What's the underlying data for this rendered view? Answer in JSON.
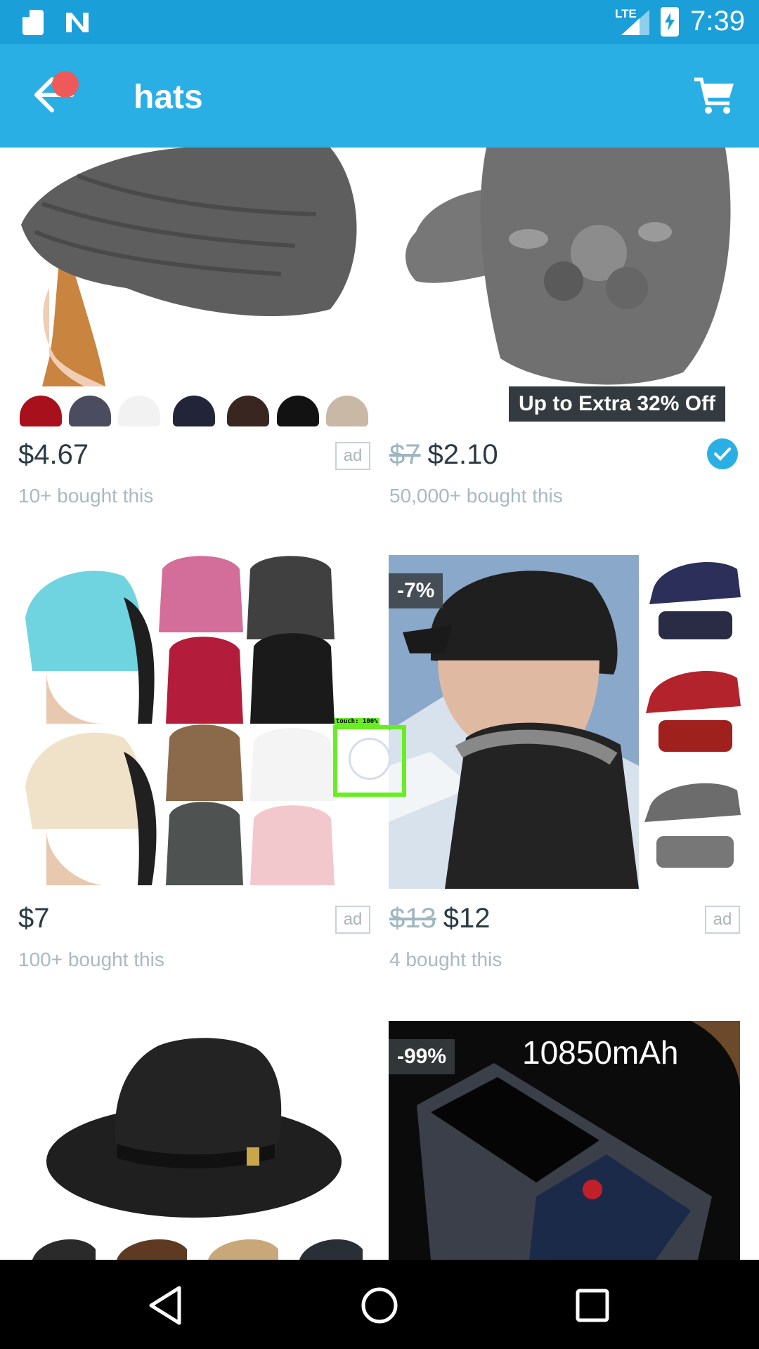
{
  "status_bar": {
    "time": "7:39",
    "network": "LTE"
  },
  "app_bar": {
    "title": "hats"
  },
  "products": [
    {
      "price": "$4.67",
      "sold": "10+ bought this",
      "ad": "ad",
      "swatch_colors": [
        "#a8101c",
        "#4c4c60",
        "#f2f2f2",
        "#22243a",
        "#3a2620",
        "#121212",
        "#c9b8a6"
      ]
    },
    {
      "old_price": "$7",
      "price": "$2.10",
      "sold": "50,000+ bought this",
      "banner": "Up to Extra 32% Off",
      "verified": true
    },
    {
      "price": "$7",
      "sold": "100+ bought this",
      "ad": "ad"
    },
    {
      "discount": "-7%",
      "old_price": "$13",
      "price": "$12",
      "sold": "4 bought this",
      "ad": "ad"
    },
    {},
    {
      "discount": "-99%",
      "image_text": "10850mAh"
    }
  ],
  "touch": {
    "label": "touch: 100%"
  },
  "colors": {
    "status_bar": "#1a9fd8",
    "app_bar": "#2aafe5",
    "price": "#2b3b45",
    "muted": "#a9b9c2"
  }
}
